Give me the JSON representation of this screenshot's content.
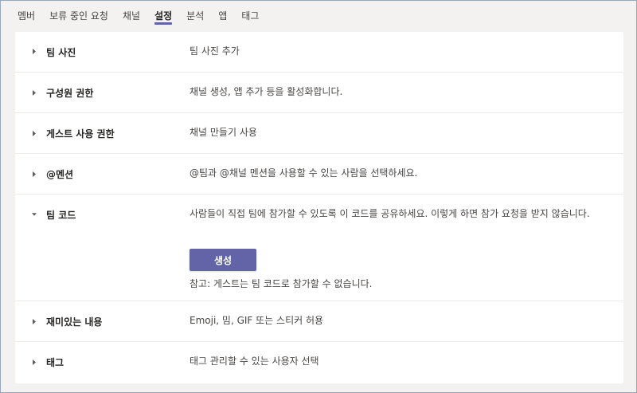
{
  "tabs": [
    {
      "label": "멤버",
      "active": false
    },
    {
      "label": "보류 중인 요청",
      "active": false
    },
    {
      "label": "채널",
      "active": false
    },
    {
      "label": "설정",
      "active": true
    },
    {
      "label": "분석",
      "active": false
    },
    {
      "label": "앱",
      "active": false
    },
    {
      "label": "태그",
      "active": false
    }
  ],
  "settings": {
    "team_photo": {
      "label": "팀 사진",
      "value": "팀 사진 추가",
      "expanded": false
    },
    "member_permissions": {
      "label": "구성원 권한",
      "value": "채널 생성, 앱 추가 등을 활성화합니다.",
      "expanded": false
    },
    "guest_permissions": {
      "label": "게스트 사용 권한",
      "value": "채널 만들기 사용",
      "expanded": false
    },
    "mentions": {
      "label": "@멘션",
      "value": "@팀과 @채널 멘션을 사용할 수 있는 사람을 선택하세요.",
      "expanded": false
    },
    "team_code": {
      "label": "팀 코드",
      "value": "사람들이 직접 팀에 참가할 수 있도록 이 코드를 공유하세요. 이렇게 하면 참가 요청을 받지 않습니다.",
      "button_label": "생성",
      "note": "참고: 게스트는 팀 코드로 참가할 수 없습니다.",
      "expanded": true
    },
    "fun_stuff": {
      "label": "재미있는 내용",
      "value": "Emoji, 밈, GIF 또는 스티커 허용",
      "expanded": false
    },
    "tags": {
      "label": "태그",
      "value": "태그 관리할 수 있는 사용자 선택",
      "expanded": false
    }
  },
  "colors": {
    "accent": "#6264a7",
    "background": "#f3f2f1",
    "panel": "#ffffff"
  }
}
